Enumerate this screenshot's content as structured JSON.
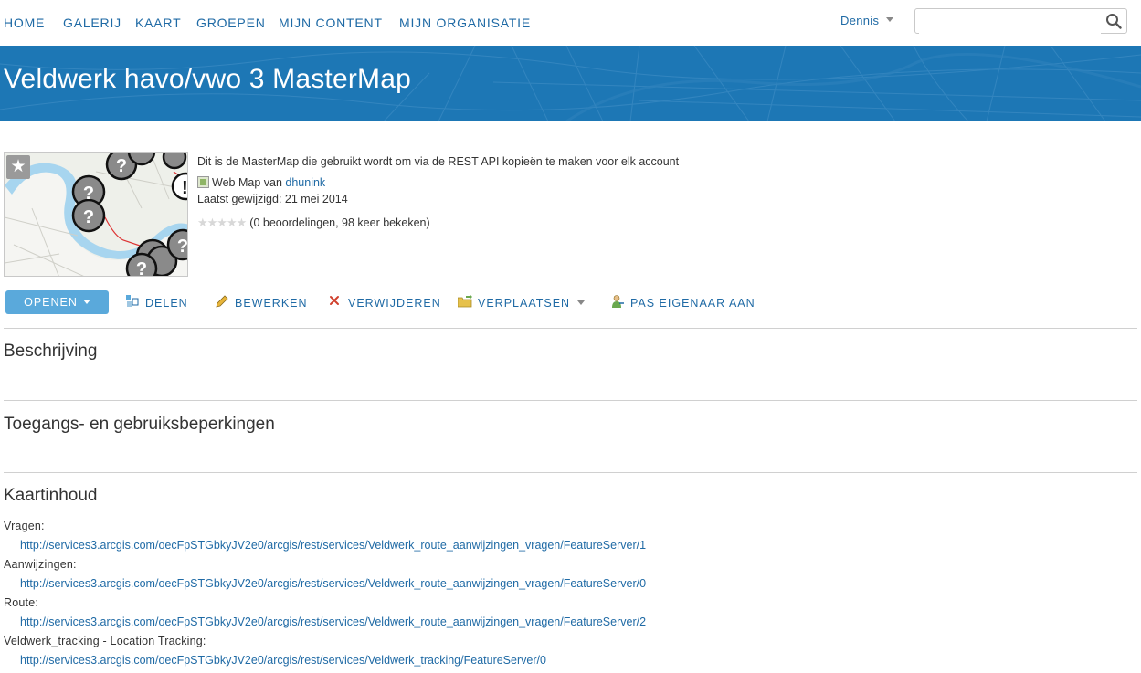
{
  "nav": {
    "items": [
      "HOME",
      "GALERIJ",
      "KAART",
      "GROEPEN",
      "MIJN CONTENT",
      "MIJN ORGANISATIE"
    ],
    "user": "Dennis",
    "search_value": ""
  },
  "banner": {
    "title": "Veldwerk havo/vwo 3 MasterMap"
  },
  "item": {
    "summary": "Dit is de MasterMap die gebruikt wordt om via de REST API kopieën te maken voor elk account",
    "type_prefix": "Web Map van",
    "owner": "dhunink",
    "modified": "Laatst gewijzigd: 21 mei 2014",
    "rating_stars": "★★★★★",
    "rating_text": "(0 beoordelingen, 98 keer bekeken)"
  },
  "toolbar": {
    "open": "OPENEN",
    "share": "DELEN",
    "edit": "BEWERKEN",
    "delete": "VERWIJDEREN",
    "move": "VERPLAATSEN",
    "change_owner": "PAS EIGENAAR AAN"
  },
  "sections": {
    "description": "Beschrijving",
    "access": "Toegangs- en gebruiksbeperkingen",
    "contents": "Kaartinhoud"
  },
  "layers": [
    {
      "name": "Vragen:",
      "url": "http://services3.arcgis.com/oecFpSTGbkyJV2e0/arcgis/rest/services/Veldwerk_route_aanwijzingen_vragen/FeatureServer/1"
    },
    {
      "name": "Aanwijzingen:",
      "url": "http://services3.arcgis.com/oecFpSTGbkyJV2e0/arcgis/rest/services/Veldwerk_route_aanwijzingen_vragen/FeatureServer/0"
    },
    {
      "name": "Route:",
      "url": "http://services3.arcgis.com/oecFpSTGbkyJV2e0/arcgis/rest/services/Veldwerk_route_aanwijzingen_vragen/FeatureServer/2"
    },
    {
      "name": "Veldwerk_tracking - Location Tracking:",
      "url": "http://services3.arcgis.com/oecFpSTGbkyJV2e0/arcgis/rest/services/Veldwerk_tracking/FeatureServer/0"
    }
  ],
  "colors": {
    "accent": "#1f6aa5",
    "banner": "#1d77b5",
    "button": "#5aa9db"
  }
}
